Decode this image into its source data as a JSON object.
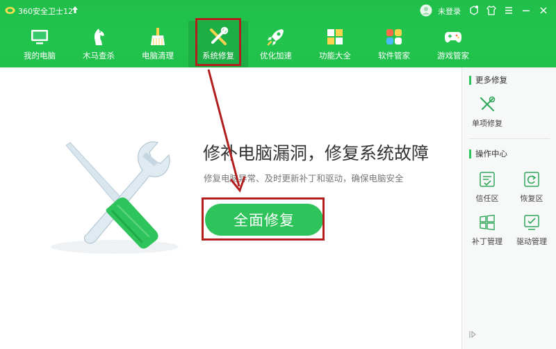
{
  "app": {
    "title": "360安全卫士12",
    "login_text": "未登录"
  },
  "nav": {
    "items": [
      {
        "label": "我的电脑",
        "icon": "monitor-icon"
      },
      {
        "label": "木马查杀",
        "icon": "horse-icon"
      },
      {
        "label": "电脑清理",
        "icon": "broom-icon"
      },
      {
        "label": "系统修复",
        "icon": "wrench-screwdriver-icon",
        "active": true
      },
      {
        "label": "优化加速",
        "icon": "rocket-icon"
      },
      {
        "label": "功能大全",
        "icon": "grid-icon"
      },
      {
        "label": "软件管家",
        "icon": "flower-grid-icon"
      },
      {
        "label": "游戏管家",
        "icon": "gamepad-icon"
      }
    ]
  },
  "main": {
    "headline": "修补电脑漏洞，修复系统故障",
    "subline": "修复电脑异常、及时更新补丁和驱动，确保电脑安全",
    "repair_button": "全面修复"
  },
  "sidebar": {
    "more_repair_title": "更多修复",
    "single_repair_label": "单项修复",
    "ops_center_title": "操作中心",
    "ops_items": [
      {
        "label": "信任区",
        "icon": "trust-zone-icon"
      },
      {
        "label": "恢复区",
        "icon": "restore-zone-icon"
      },
      {
        "label": "补丁管理",
        "icon": "windows-patch-icon"
      },
      {
        "label": "驱动管理",
        "icon": "driver-icon"
      }
    ]
  },
  "colors": {
    "brand_green": "#22c44e",
    "button_green": "#2fc45b",
    "annotation_red": "#b21d1d"
  }
}
